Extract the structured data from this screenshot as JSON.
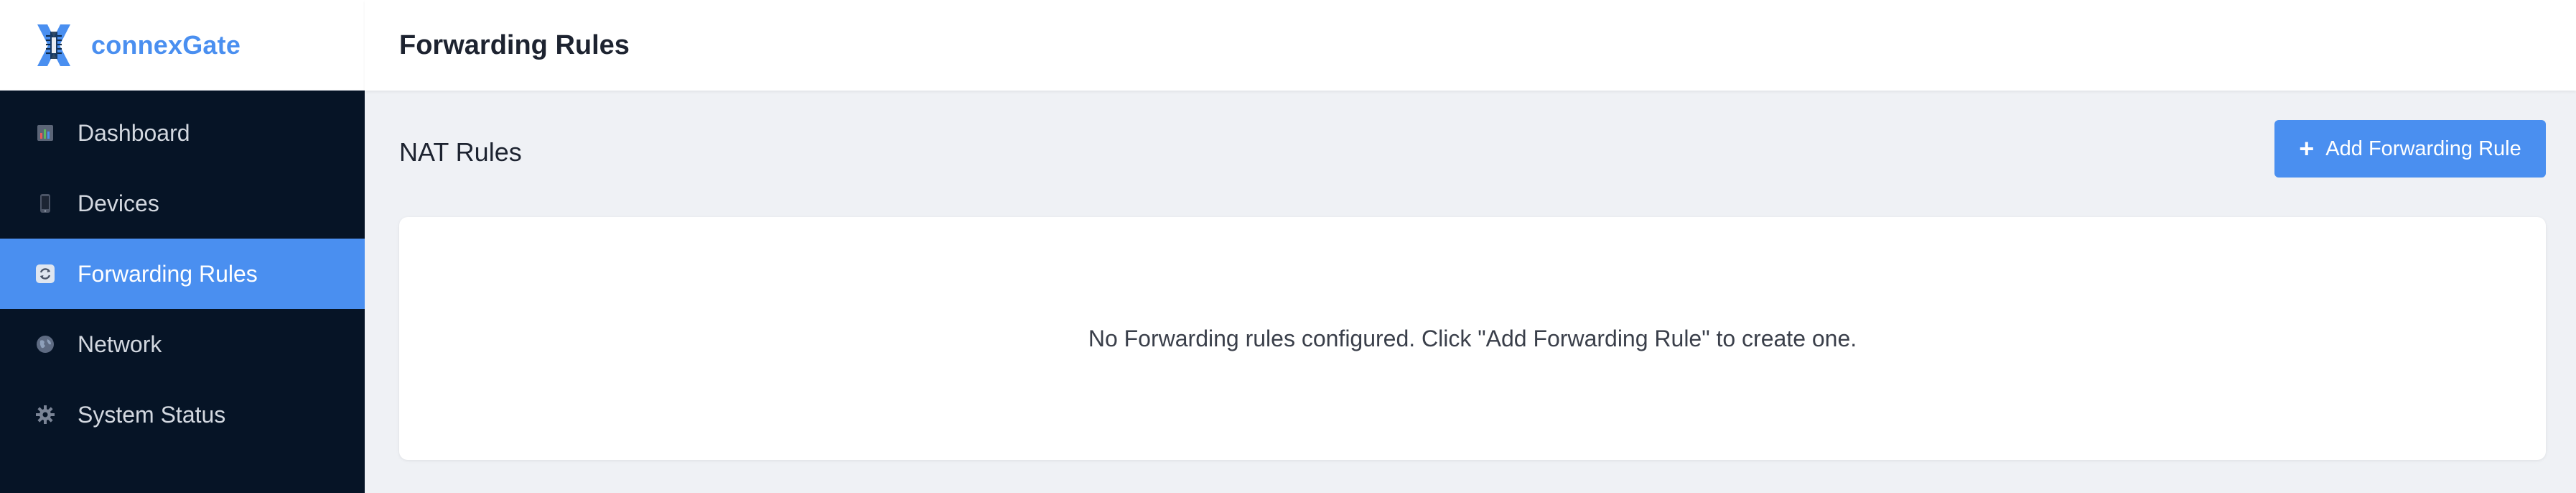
{
  "brand": {
    "name": "connexGate",
    "logo_icon": "connexgate-x-logo",
    "colors": {
      "accent": "#4a8ff0",
      "sidebar_bg": "#061426"
    }
  },
  "sidebar": {
    "items": [
      {
        "label": "Dashboard",
        "icon": "bar-chart-icon",
        "active": false
      },
      {
        "label": "Devices",
        "icon": "mobile-phone-icon",
        "active": false
      },
      {
        "label": "Forwarding Rules",
        "icon": "refresh-icon",
        "active": true
      },
      {
        "label": "Network",
        "icon": "globe-icon",
        "active": false
      },
      {
        "label": "System Status",
        "icon": "gear-icon",
        "active": false
      }
    ]
  },
  "header": {
    "title": "Forwarding Rules"
  },
  "main": {
    "section_title": "NAT Rules",
    "add_button_label": "Add Forwarding Rule",
    "empty_message": "No Forwarding rules configured. Click \"Add Forwarding Rule\" to create one."
  }
}
